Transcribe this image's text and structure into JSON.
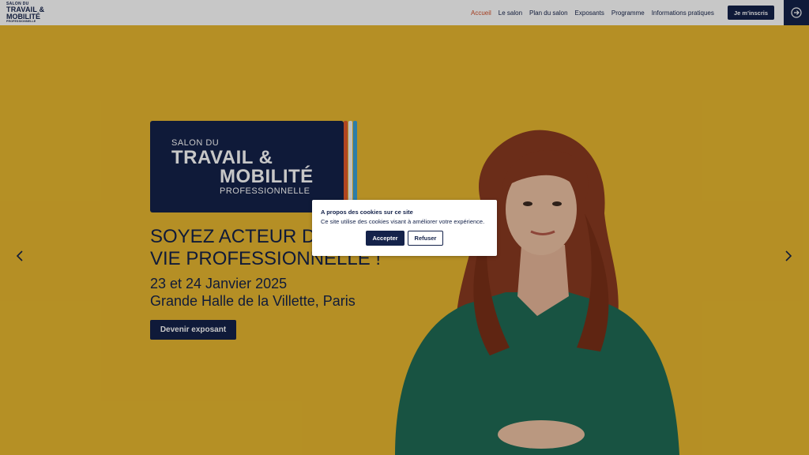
{
  "header": {
    "logo": {
      "line1": "SALON DU",
      "line2": "TRAVAIL &",
      "line3": "MOBILITÉ",
      "line4": "PROFESSIONNELLE"
    },
    "nav": [
      {
        "label": "Accueil",
        "active": true
      },
      {
        "label": "Le salon"
      },
      {
        "label": "Plan du salon"
      },
      {
        "label": "Exposants"
      },
      {
        "label": "Programme"
      },
      {
        "label": "Informations pratiques"
      }
    ],
    "register_label": "Je m'inscris",
    "login_icon": "arrow-circle-right-icon"
  },
  "hero": {
    "brand": {
      "line1": "SALON DU",
      "line2": "TRAVAIL &",
      "line3": "MOBILITÉ",
      "line4": "PROFESSIONNELLE"
    },
    "headline_line1": "SOYEZ ACTEUR D",
    "headline_line2": "VIE PROFESSIONNELLE !",
    "date": "23 et 24 Janvier 2025",
    "location": "Grande Halle de la Villette, Paris",
    "cta_label": "Devenir exposant",
    "prev_icon": "chevron-left-icon",
    "next_icon": "chevron-right-icon"
  },
  "cookie": {
    "title": "A propos des cookies sur ce site",
    "text": "Ce site utilise des cookies visant à améliorer votre expérience.",
    "accept_label": "Accepter",
    "refuse_label": "Refuser"
  },
  "colors": {
    "navy": "#14224a",
    "accent_orange": "#d2502c",
    "hero_yellow": "#e8b830"
  }
}
